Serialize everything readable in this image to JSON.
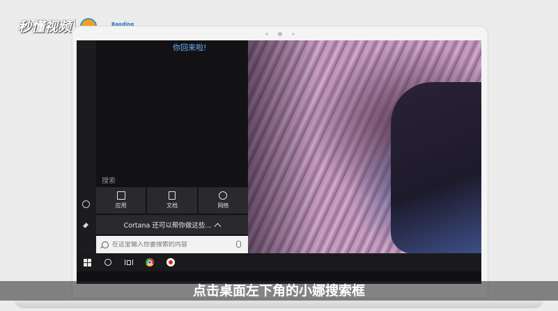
{
  "watermark": {
    "logo_text": "秒懂视频",
    "partner_text": "Baoding"
  },
  "start_panel": {
    "greeting": "你回来啦!",
    "search_heading": "搜索",
    "tiles": [
      {
        "icon": "app-icon",
        "label": "应用"
      },
      {
        "icon": "document-icon",
        "label": "文档"
      },
      {
        "icon": "globe-icon",
        "label": "网络"
      }
    ],
    "cortana_prompt": "Cortana 还可以帮你做这些...",
    "search_placeholder": "在这里输入你要搜索的内容"
  },
  "taskbar": {
    "items": [
      "windows-start-icon",
      "cortana-circle-icon",
      "task-view-icon",
      "chrome-icon",
      "record-icon"
    ]
  },
  "subtitle": "点击桌面左下角的小娜搜索框",
  "colors": {
    "greeting_blue": "#6fb1ff",
    "panel_bg": "#121214",
    "tile_bg": "#2a2a2e",
    "taskbar_bg": "#1a1a1c"
  }
}
